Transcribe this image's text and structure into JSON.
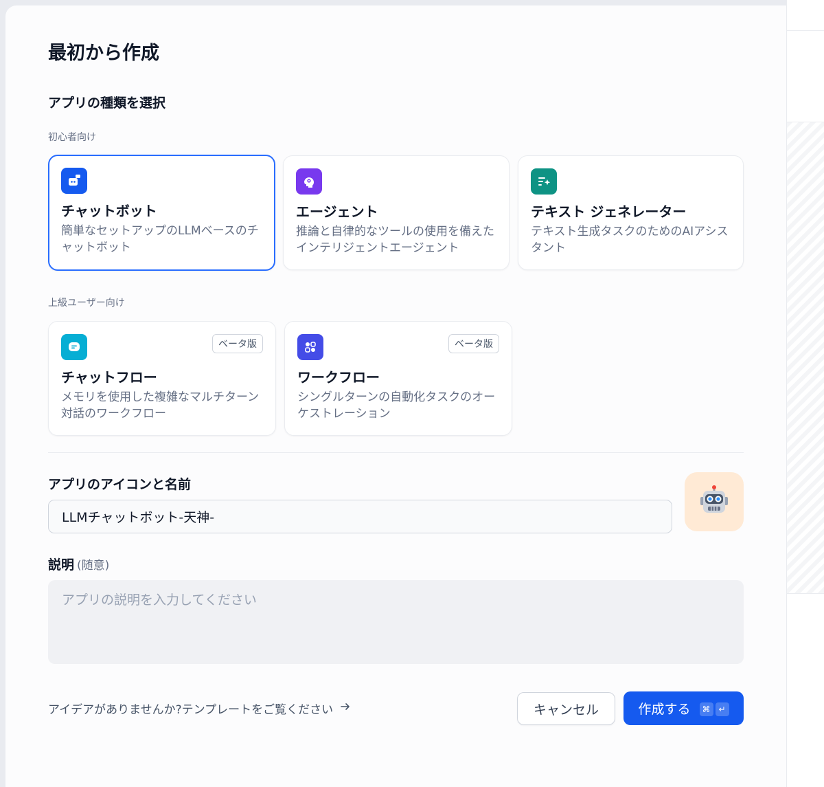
{
  "dialog": {
    "title": "最初から作成",
    "type_section_title": "アプリの種類を選択",
    "beginner_label": "初心者向け",
    "advanced_label": "上級ユーザー向け"
  },
  "app_types": {
    "chatbot": {
      "title": "チャットボット",
      "desc": "簡単なセットアップのLLMベースのチャットボット",
      "icon": "chatbot-robot-icon",
      "color": "#155aef"
    },
    "agent": {
      "title": "エージェント",
      "desc": "推論と自律的なツールの使用を備えたインテリジェントエージェント",
      "icon": "agent-head-gear-icon",
      "color": "#7839ee"
    },
    "text_gen": {
      "title": "テキスト ジェネレーター",
      "desc": "テキスト生成タスクのためのAIアシスタント",
      "icon": "text-sparkle-icon",
      "color": "#0e9384"
    },
    "chatflow": {
      "title": "チャットフロー",
      "desc": "メモリを使用した複雑なマルチターン対話のワークフロー",
      "badge": "ベータ版",
      "icon": "chatflow-bubble-icon",
      "color": "#06aed4"
    },
    "workflow": {
      "title": "ワークフロー",
      "desc": "シングルターンの自動化タスクのオーケストレーション",
      "badge": "ベータ版",
      "icon": "workflow-nodes-icon",
      "color": "#444ce7"
    }
  },
  "form": {
    "name_section_title": "アプリのアイコンと名前",
    "name_value": "LLMチャットボット-天神-",
    "app_icon": "robot-emoji-icon",
    "app_icon_bg": "#ffead5",
    "desc_label": "説明",
    "desc_optional": "(随意)",
    "desc_placeholder": "アプリの説明を入力してください"
  },
  "footer": {
    "template_link": "アイデアがありませんか?テンプレートをご覧ください",
    "cancel_label": "キャンセル",
    "create_label": "作成する",
    "shortcut_cmd": "⌘",
    "shortcut_enter": "↵"
  },
  "colors": {
    "accent": "#155aef",
    "selected_border": "#296dff"
  }
}
